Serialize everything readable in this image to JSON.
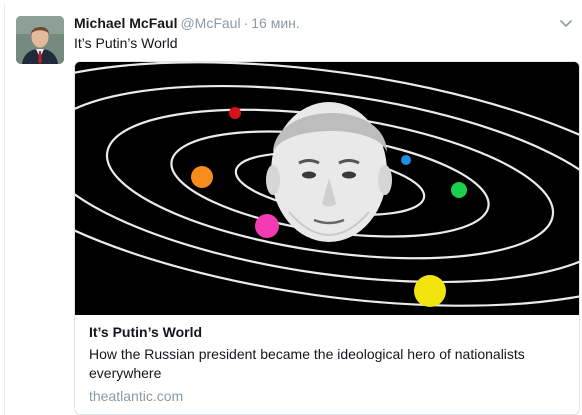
{
  "tweet": {
    "author_name": "Michael McFaul",
    "handle": "@McFaul",
    "separator": "·",
    "time": "16 мин.",
    "text": "It’s Putin’s World"
  },
  "card": {
    "title": "It’s Putin’s World",
    "description": "How the Russian president became the ideological hero of nationalists everywhere",
    "domain": "theatlantic.com"
  },
  "icons": {
    "menu": "chevron-down-icon"
  },
  "colors": {
    "planet_red": "#d6121a",
    "planet_orange": "#f58c1c",
    "planet_pink": "#f43bb4",
    "planet_blue": "#1e8fe6",
    "planet_green": "#1ccf4a",
    "planet_yellow": "#f2e30c"
  }
}
